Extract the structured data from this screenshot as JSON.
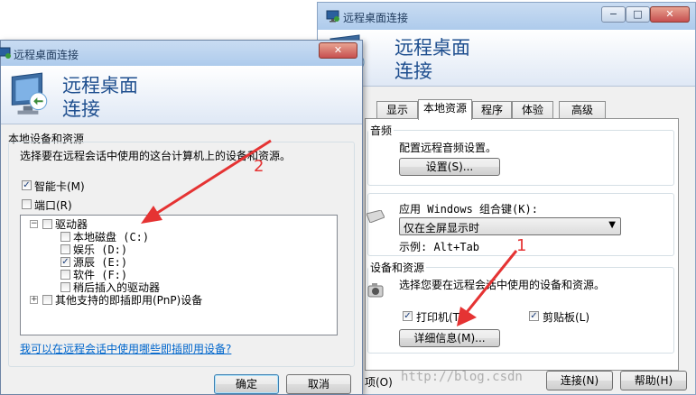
{
  "back_window": {
    "title": "远程桌面连接",
    "header_line1": "远程桌面",
    "header_line2": "连接",
    "caption_minimize": "−",
    "caption_maximize": "□",
    "caption_close": "✕",
    "tabs": [
      "显示",
      "本地资源",
      "程序",
      "体验",
      "高级"
    ],
    "active_tab": "本地资源",
    "audio": {
      "legend": "音频",
      "description": "配置远程音频设置。",
      "settings_button": "设置(S)..."
    },
    "keyboard": {
      "label": "应用 Windows 组合键(K):",
      "selected": "仅在全屏显示时",
      "example": "示例: Alt+Tab"
    },
    "devices": {
      "legend": "设备和资源",
      "description": "选择您要在远程会话中使用的设备和资源。",
      "printer_label": "打印机(T)",
      "printer_checked": true,
      "clipboard_label": "剪贴板(L)",
      "clipboard_checked": true,
      "details_button": "详细信息(M)..."
    },
    "footer": {
      "options_label": "项(O)",
      "connect_button": "连接(N)",
      "help_button": "帮助(H)"
    }
  },
  "front_window": {
    "title": "远程桌面连接",
    "caption_close": "✕",
    "header_line1": "远程桌面",
    "header_line2": "连接",
    "section_title": "本地设备和资源",
    "description": "选择要在远程会话中使用的这台计算机上的设备和资源。",
    "smartcard_label": "智能卡(M)",
    "smartcard_checked": true,
    "ports_label": "端口(R)",
    "ports_checked": false,
    "tree": {
      "drives_label": "驱动器",
      "drives_expander": "−",
      "drives": [
        {
          "label": "本地磁盘 (C:)",
          "checked": false
        },
        {
          "label": "娱乐 (D:)",
          "checked": false
        },
        {
          "label": "源辰 (E:)",
          "checked": true
        },
        {
          "label": "软件 (F:)",
          "checked": false
        },
        {
          "label": "稍后插入的驱动器",
          "checked": false
        }
      ],
      "pnp_label": "其他支持的即插即用(PnP)设备",
      "pnp_expander": "+"
    },
    "help_link": "我可以在远程会话中使用哪些即插即用设备?",
    "ok_button": "确定",
    "cancel_button": "取消"
  },
  "annotations": {
    "label_1": "1",
    "label_2": "2",
    "color": "#e53333"
  },
  "watermark": "http://blog.csdn"
}
